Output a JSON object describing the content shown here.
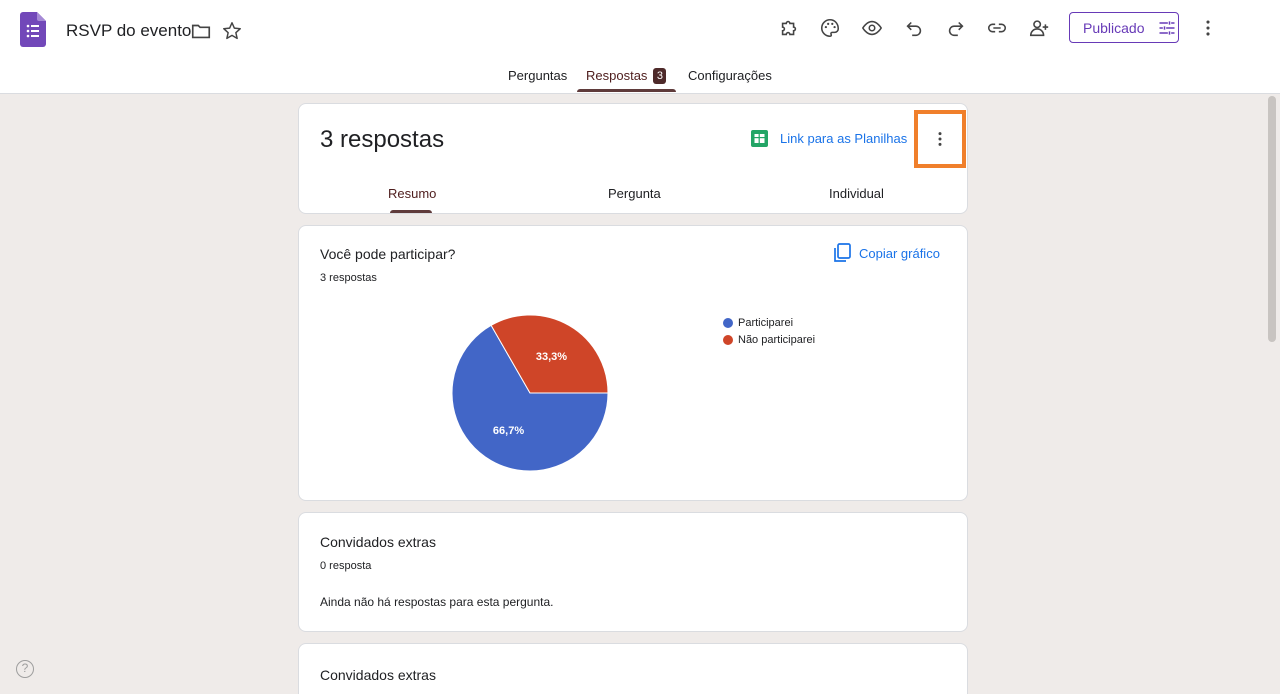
{
  "app": {
    "title": "RSVP do evento",
    "publish_label": "Publicado",
    "brand_color": "#673ab7"
  },
  "toolbar_icons": [
    "puzzle-icon",
    "palette-icon",
    "eye-icon",
    "undo-icon",
    "redo-icon",
    "link-icon",
    "add-person-icon",
    "more-vert-icon"
  ],
  "tabs": {
    "questions": "Perguntas",
    "responses": "Respostas",
    "responses_badge": "3",
    "settings": "Configurações"
  },
  "summary_card": {
    "count_label": "3 respostas",
    "sheets_link": "Link para as Planilhas",
    "subtabs": {
      "summary": "Resumo",
      "question": "Pergunta",
      "individual": "Individual"
    }
  },
  "question1": {
    "title": "Você pode participar?",
    "count": "3 respostas",
    "copy_chart": "Copiar gráfico"
  },
  "chart_data": {
    "type": "pie",
    "categories": [
      "Participarei",
      "Não participarei"
    ],
    "values": [
      66.7,
      33.3
    ],
    "data_labels": [
      "66,7%",
      "33,3%"
    ],
    "colors": [
      "#4266c7",
      "#cf4528"
    ],
    "legend_position": "right"
  },
  "question2": {
    "title": "Convidados extras",
    "count": "0 resposta",
    "empty_message": "Ainda não há respostas para esta pergunta."
  },
  "question3": {
    "title": "Convidados extras"
  },
  "help": "?"
}
